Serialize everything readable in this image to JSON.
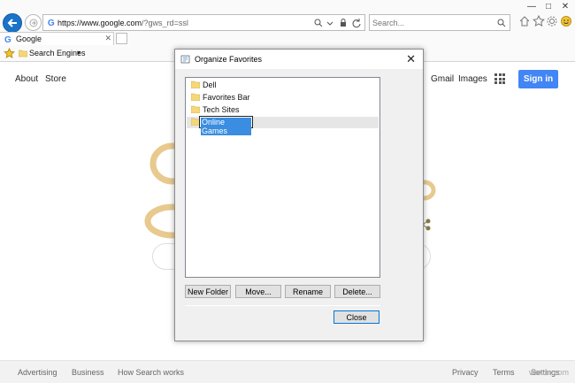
{
  "browser": {
    "address": {
      "host": "https://www.google.com",
      "path": "/?gws_rd=ssl"
    },
    "search_placeholder": "Search...",
    "tab_title": "Google",
    "favorites_bar": {
      "folder_label": "Search Engines"
    }
  },
  "page": {
    "top_links": [
      "About",
      "Store"
    ],
    "right_links": [
      "Gmail",
      "Images"
    ],
    "signin_label": "Sign in",
    "footer_left": [
      "Advertising",
      "Business",
      "How Search works"
    ],
    "footer_right": [
      "Privacy",
      "Terms",
      "Settings"
    ],
    "watermark": "wsxdn.com"
  },
  "dialog": {
    "title": "Organize Favorites",
    "items": [
      {
        "label": "Dell"
      },
      {
        "label": "Favorites Bar"
      },
      {
        "label": "Tech Sites"
      }
    ],
    "editing_value": "Online Games",
    "buttons": {
      "new_folder": "New Folder",
      "move": "Move...",
      "rename": "Rename",
      "delete": "Delete...",
      "close": "Close"
    }
  },
  "colors": {
    "accent_blue": "#1a73c8",
    "signin_blue": "#4285f4",
    "folder_yellow": "#f5d77a",
    "selection_blue": "#3a8de0"
  }
}
